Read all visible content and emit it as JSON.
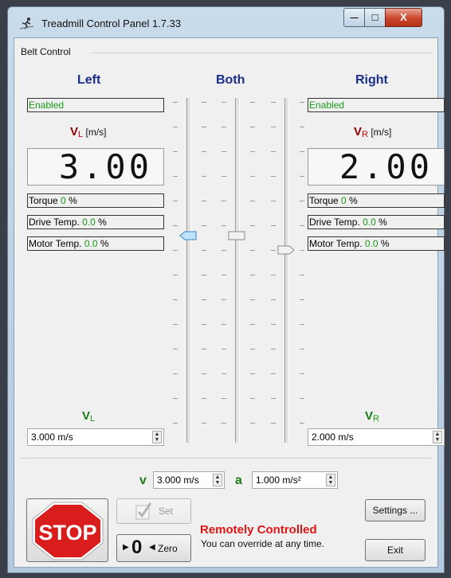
{
  "window": {
    "title": "Treadmill Control Panel 1.7.33",
    "buttons": {
      "minimize_glyph": "—",
      "maximize_glyph": "□",
      "close_glyph": "X"
    }
  },
  "group": {
    "label": "Belt Control"
  },
  "left": {
    "heading": "Left",
    "status": "Enabled",
    "velocity_symbol": "V",
    "velocity_sub": "L",
    "velocity_unit": "[m/s]",
    "display_value": "3.00",
    "torque_label": "Torque",
    "torque_value": "0",
    "drive_temp_label": "Drive Temp.",
    "drive_temp_value": "0.0",
    "motor_temp_label": "Motor Temp.",
    "motor_temp_value": "0.0",
    "percent": "%",
    "setpoint_symbol": "V",
    "setpoint_sub": "L",
    "setpoint_value": "3.000 m/s"
  },
  "both": {
    "heading": "Both"
  },
  "right": {
    "heading": "Right",
    "status": "Enabled",
    "velocity_symbol": "V",
    "velocity_sub": "R",
    "velocity_unit": "[m/s]",
    "display_value": "2.00",
    "torque_label": "Torque",
    "torque_value": "0",
    "drive_temp_label": "Drive Temp.",
    "drive_temp_value": "0.0",
    "motor_temp_label": "Motor Temp.",
    "motor_temp_value": "0.0",
    "percent": "%",
    "setpoint_symbol": "V",
    "setpoint_sub": "R",
    "setpoint_value": "2.000 m/s"
  },
  "sliders": {
    "left_value": 3.0,
    "both_value": 3.0,
    "right_value": 2.0
  },
  "common": {
    "v_label": "v",
    "v_value": "3.000 m/s",
    "a_label": "a",
    "a_value": "1.000 m/s²"
  },
  "controls": {
    "stop_label": "STOP",
    "set_label": "Set",
    "zero_digit": "0",
    "zero_label": "Zero",
    "settings_label": "Settings ...",
    "exit_label": "Exit"
  },
  "remote": {
    "title": "Remotely Controlled",
    "subtitle": "You can override at any time."
  },
  "colors": {
    "heading_blue": "#1a2d8c",
    "status_green": "#1a9a1a",
    "velocity_red": "#8b0000",
    "stop_red": "#d91c1c",
    "remote_red": "#e01515"
  }
}
